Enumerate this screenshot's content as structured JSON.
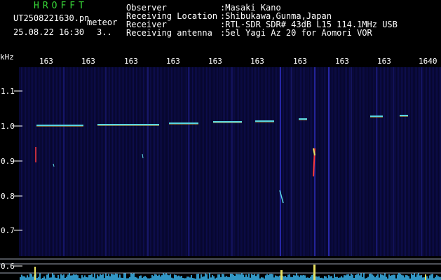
{
  "app": {
    "title": "HROFFT",
    "file_name": "UT2508221630.pn",
    "mode": "meteor",
    "date_time": "25.08.22 16:30",
    "count": "3.."
  },
  "info": [
    {
      "label": "Observer",
      "value": ":Masaki Kano"
    },
    {
      "label": "Receiving Location",
      "value": ":Shibukawa,Gunma,Japan"
    },
    {
      "label": "Receiver",
      "value": ":RTL-SDR SDR# 43dB L15 114.1MHz USB"
    },
    {
      "label": "Receiving antenna",
      "value": ":5el Yagi Az 20 for Aomori VOR"
    }
  ],
  "axes": {
    "y_unit": "kHz",
    "y_ticks": [
      "1.1",
      "1.0",
      "0.9",
      "0.8",
      "0.7",
      "0.6"
    ],
    "x_ticks": [
      "163",
      "163",
      "163",
      "163",
      "163",
      "163",
      "163",
      "163",
      "163",
      "1640"
    ]
  },
  "colors": {
    "background": "#000000",
    "noise": "#14146e",
    "carrier": "#5ad6e0",
    "meteor": "#ff3838",
    "header_green": "#38d838",
    "text": "#ffffff"
  }
}
